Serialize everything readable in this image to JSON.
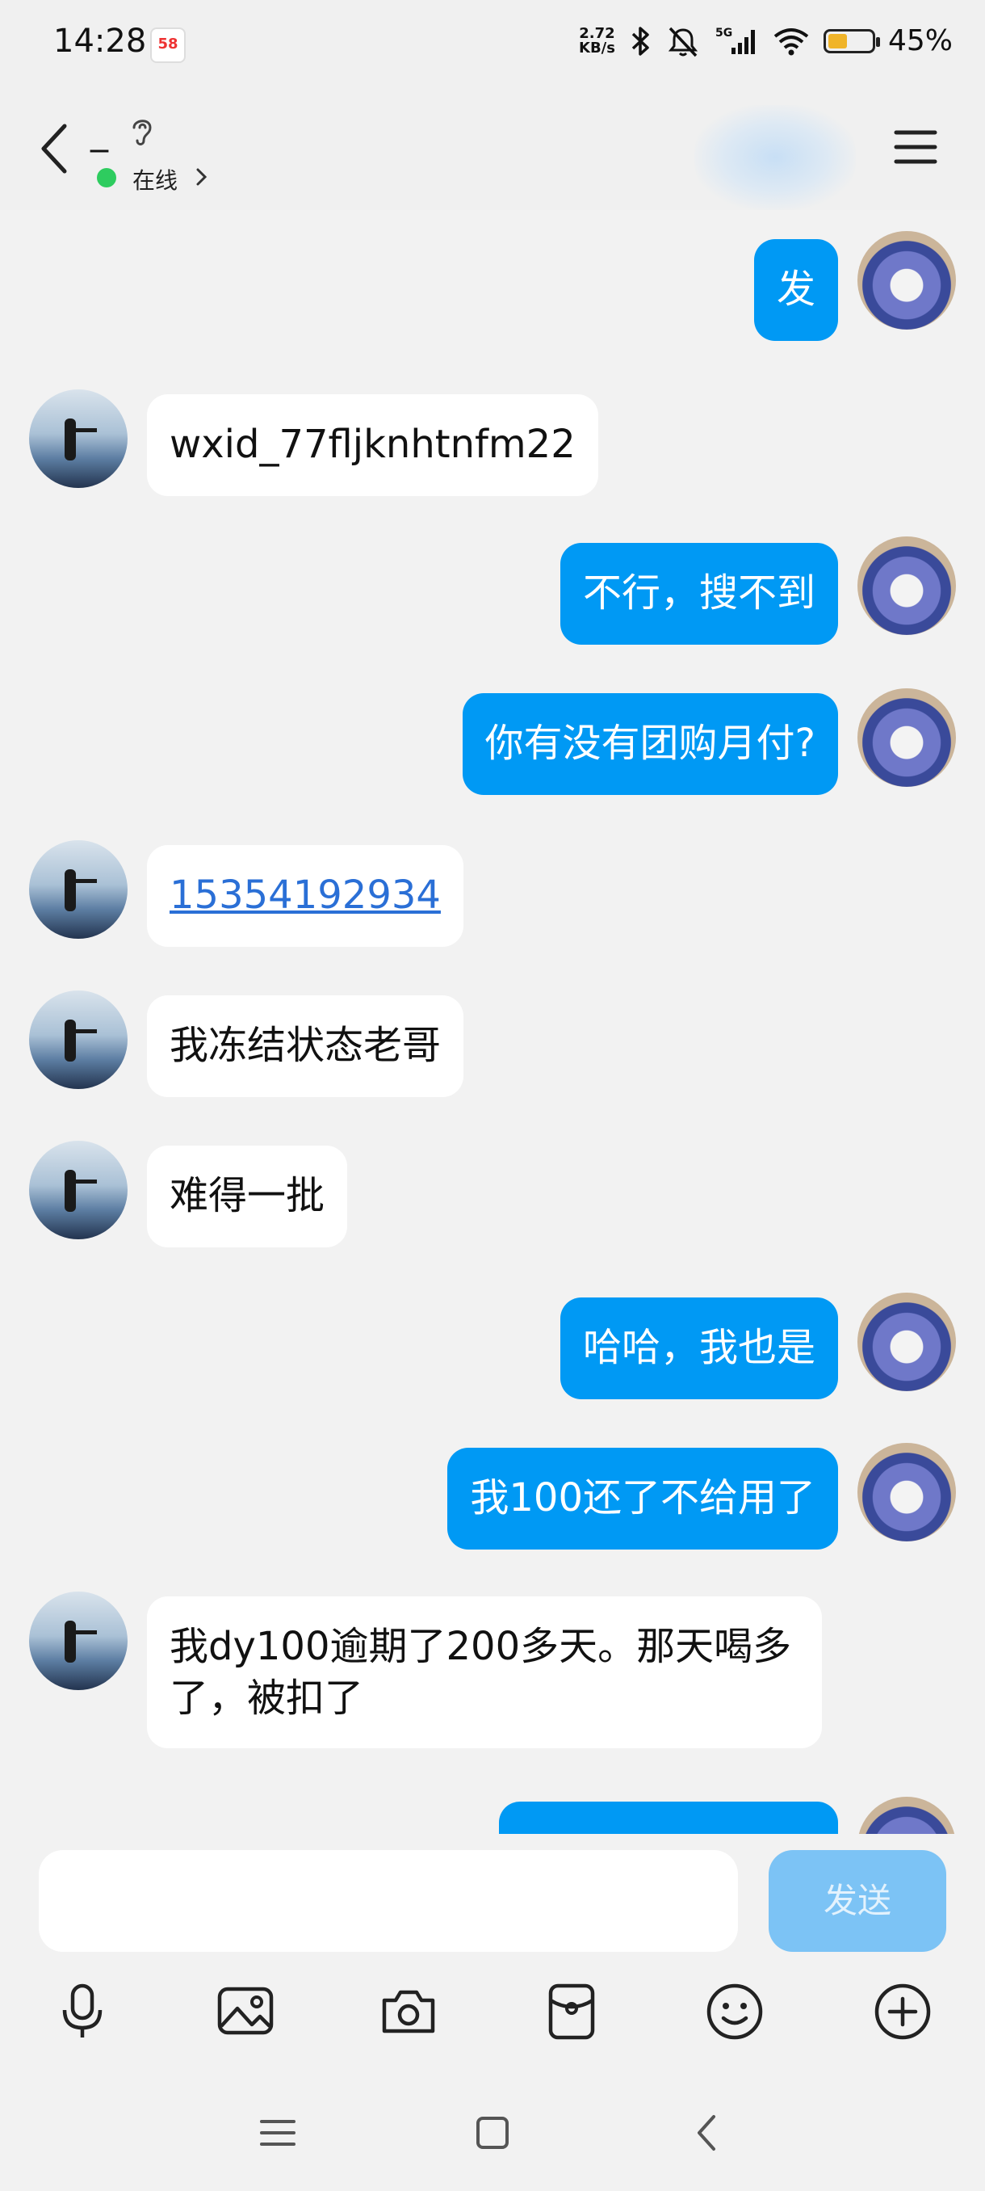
{
  "status_bar": {
    "time": "14:28",
    "app_badge": "58",
    "net_speed_value": "2.72",
    "net_speed_unit": "KB/s",
    "battery_percent": "45%",
    "battery_level": 0.45
  },
  "header": {
    "contact_name": "_",
    "online_status": "在线"
  },
  "messages": [
    {
      "side": "out",
      "text": "发"
    },
    {
      "side": "in",
      "text": "wxid_77fljknhtnfm22"
    },
    {
      "side": "out",
      "text": "不行，搜不到"
    },
    {
      "side": "out",
      "text": "你有没有团购月付?"
    },
    {
      "side": "in",
      "text": "15354192934",
      "link": true
    },
    {
      "side": "in",
      "text": "我冻结状态老哥"
    },
    {
      "side": "in",
      "text": "难得一批"
    },
    {
      "side": "out",
      "text": "哈哈，我也是"
    },
    {
      "side": "out",
      "text": "我100还了不给用了"
    },
    {
      "side": "in",
      "text": "我dy100逾期了200多天。那天喝多了，被扣了"
    }
  ],
  "input": {
    "placeholder": "",
    "send_label": "发送"
  },
  "colors": {
    "outgoing_bubble": "#0099f4",
    "incoming_bubble": "#ffffff",
    "online": "#2ecc5f",
    "send_button": "#7cc3f5",
    "background": "#f2f2f2"
  }
}
